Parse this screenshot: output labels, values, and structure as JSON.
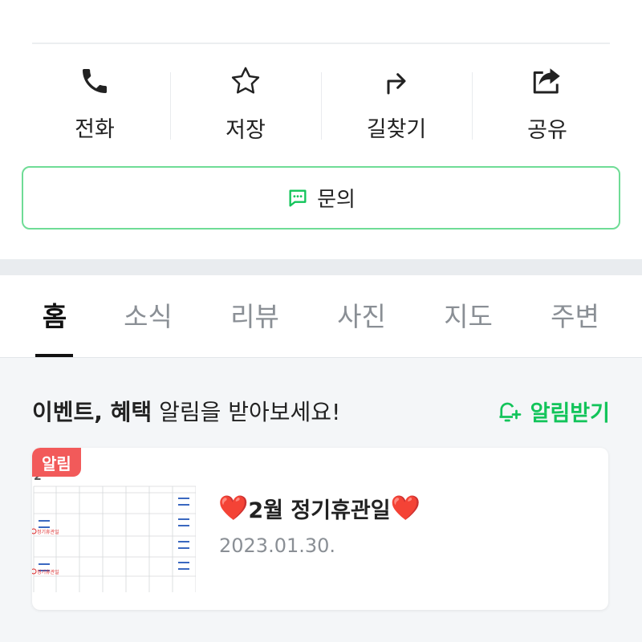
{
  "actions": [
    {
      "label": "전화",
      "icon": "phone-icon"
    },
    {
      "label": "저장",
      "icon": "star-icon"
    },
    {
      "label": "길찾기",
      "icon": "directions-icon"
    },
    {
      "label": "공유",
      "icon": "share-icon"
    }
  ],
  "inquiry": {
    "label": "문의",
    "icon": "chat-icon"
  },
  "tabs": [
    "홈",
    "소식",
    "리뷰",
    "사진",
    "지도",
    "주변"
  ],
  "active_tab": "홈",
  "notify": {
    "bold_text": "이벤트, 혜택",
    "text": " 알림을 받아보세요!",
    "button_label": "알림받기",
    "button_icon": "bell-plus-icon"
  },
  "news_card": {
    "badge": "알림",
    "heart": "❤️",
    "title": "2월 정기휴관일",
    "date": "2023.01.30.",
    "thumbnail_month": "2",
    "thumbnail_stamp": "정기휴관일"
  },
  "colors": {
    "accent_green": "#12c45a",
    "inquiry_border": "#6fdc96",
    "badge_red": "#f25a5a",
    "heart_red": "#e81c2a"
  }
}
